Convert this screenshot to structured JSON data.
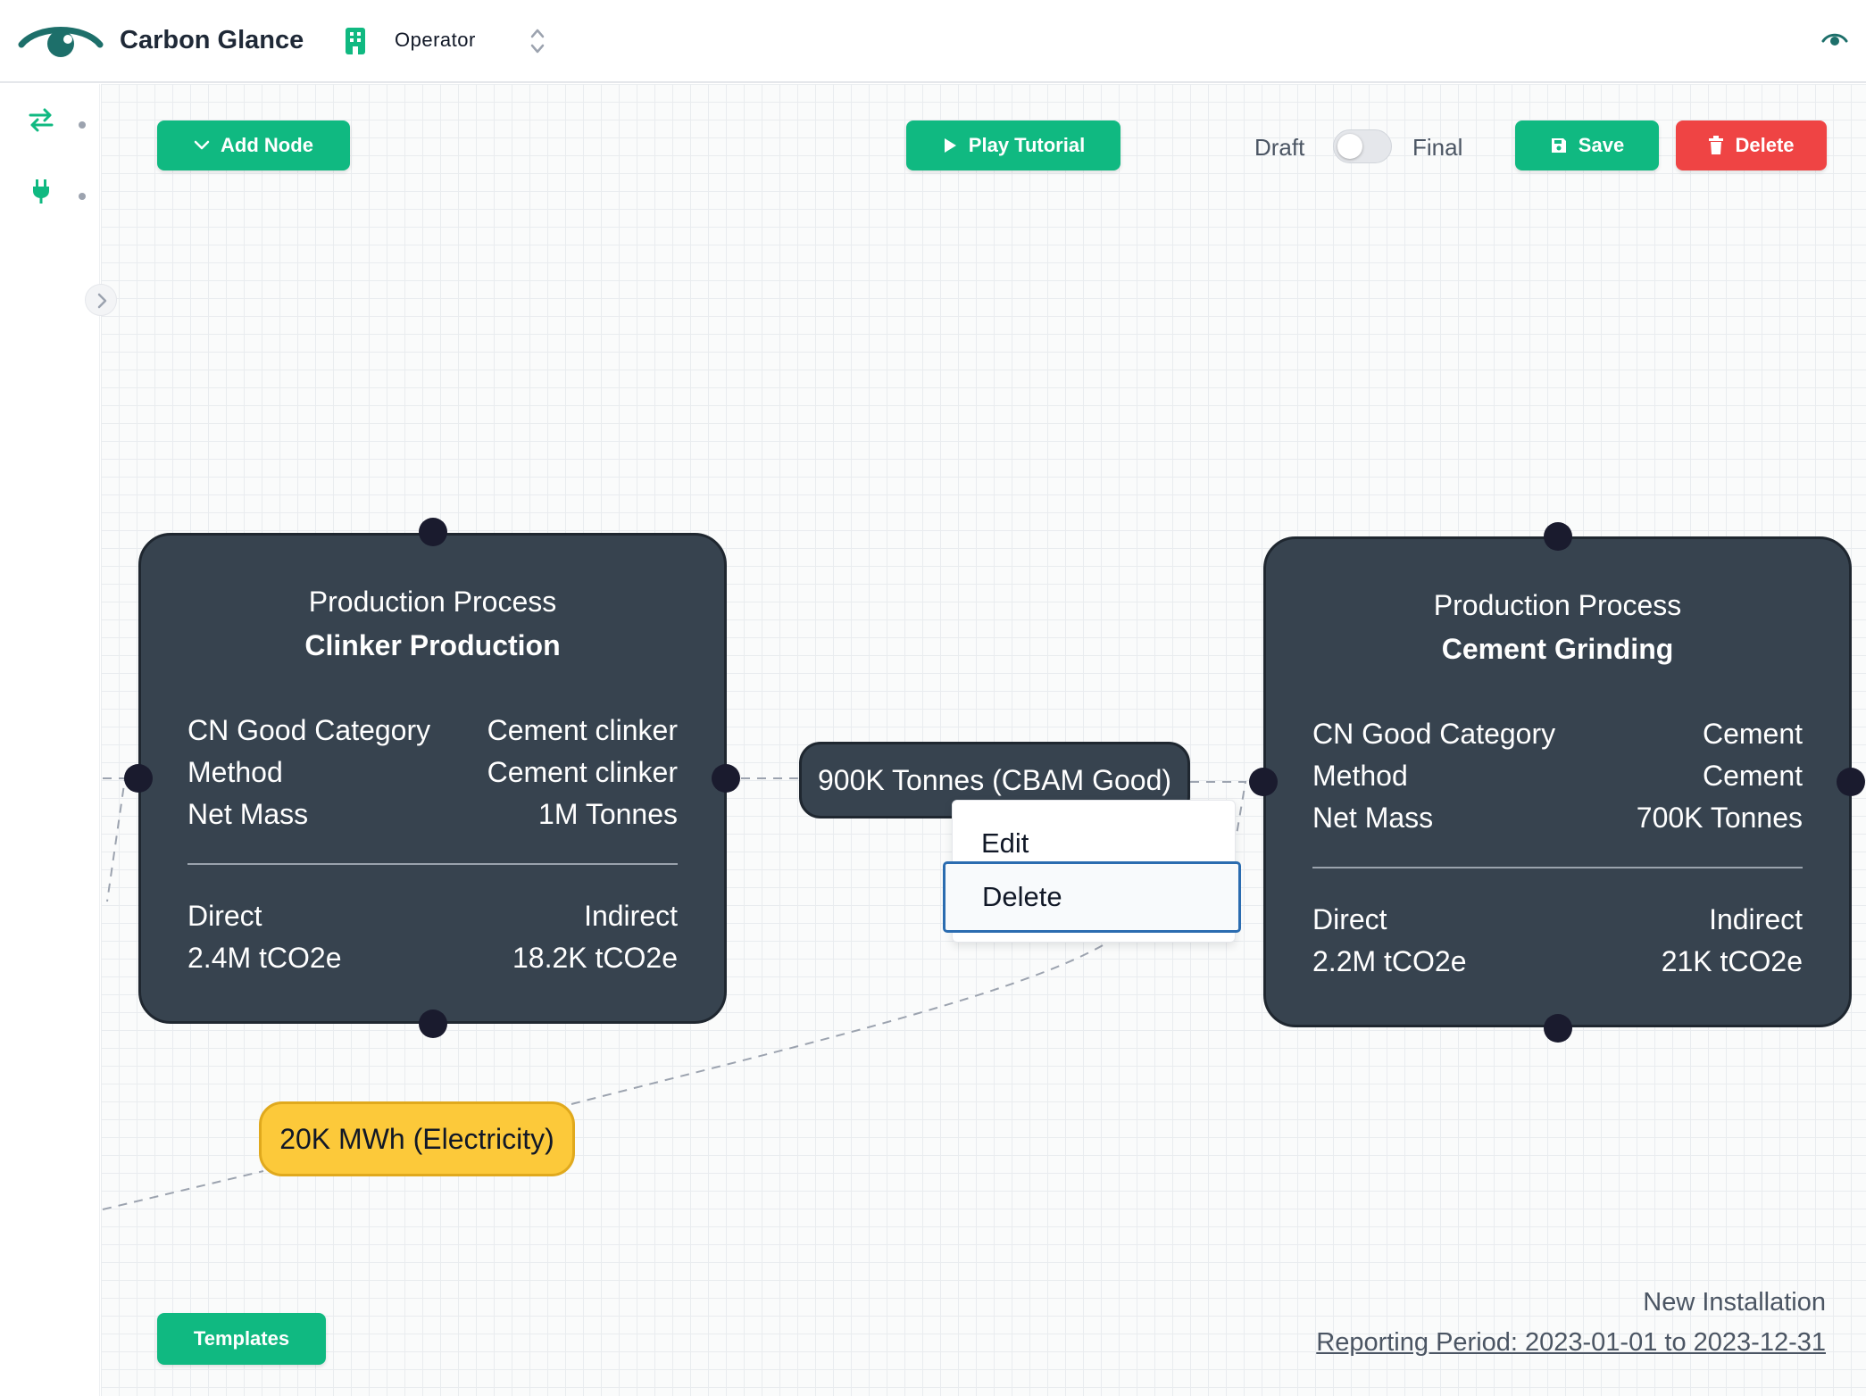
{
  "header": {
    "app_title": "Carbon Glance",
    "organization": "Operator",
    "icons": [
      "carbon-glance-logo-icon",
      "building-icon",
      "chevrons-up-down-icon",
      "eye-icon"
    ]
  },
  "sidebar": {
    "items": [
      {
        "icon": "arrows-exchange-icon"
      },
      {
        "icon": "plug-icon"
      }
    ],
    "toggle_icon": "chevron-right-icon"
  },
  "toolbar": {
    "add_node_label": "Add Node",
    "play_tutorial_label": "Play Tutorial",
    "draft_label": "Draft",
    "final_label": "Final",
    "final_on": false,
    "save_label": "Save",
    "delete_label": "Delete",
    "colors": {
      "primary": "#10b981",
      "danger": "#ef4444"
    }
  },
  "nodes": [
    {
      "type": "Production Process",
      "name": "Clinker Production",
      "rows": [
        {
          "label": "CN Good Category",
          "value": "Cement clinker"
        },
        {
          "label": "Method",
          "value": "Cement clinker"
        },
        {
          "label": "Net Mass",
          "value": "1M Tonnes"
        }
      ],
      "direct_label": "Direct",
      "direct_value": "2.4M tCO2e",
      "indirect_label": "Indirect",
      "indirect_value": "18.2K tCO2e"
    },
    {
      "type": "Production Process",
      "name": "Cement Grinding",
      "rows": [
        {
          "label": "CN Good Category",
          "value": "Cement"
        },
        {
          "label": "Method",
          "value": "Cement"
        },
        {
          "label": "Net Mass",
          "value": "700K Tonnes"
        }
      ],
      "direct_label": "Direct",
      "direct_value": "2.2M tCO2e",
      "indirect_label": "Indirect",
      "indirect_value": "21K tCO2e"
    }
  ],
  "edges": {
    "product_label": "900K Tonnes (CBAM Good)",
    "energy_label": "20K MWh (Electricity)",
    "energy_color": "#fcc93a"
  },
  "context_menu": {
    "items": [
      "Edit",
      "Delete"
    ],
    "highlighted": "Delete"
  },
  "footer": {
    "templates_label": "Templates",
    "installation": "New Installation",
    "reporting_period": "Reporting Period: 2023-01-01 to 2023-12-31"
  }
}
